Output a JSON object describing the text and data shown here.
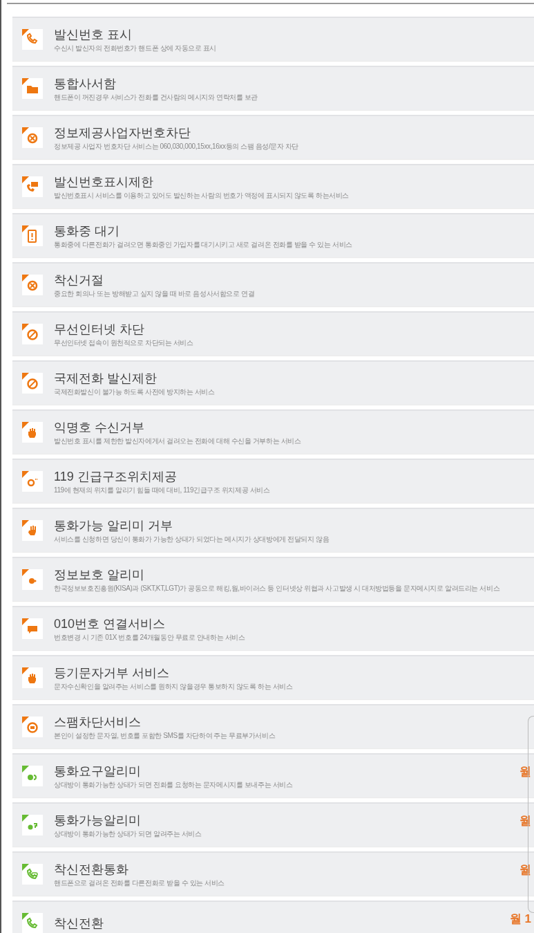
{
  "services": [
    {
      "kind": "free",
      "title": "발신번호 표시",
      "description": "수신시 발신자의 전화번호가 핸드폰 상에 자동으로 표시"
    },
    {
      "kind": "free",
      "title": "통합사서함",
      "description": "핸드폰이 꺼진경우 서비스가 전화를 건사람의 메시지와 연락처를 보관"
    },
    {
      "kind": "free",
      "title": "정보제공사업자번호차단",
      "description": "정보제공 사업자 번호차단 서비스는 060,030,000,15xx,16xx등의 스팸 음성/문자 차단"
    },
    {
      "kind": "free",
      "title": "발신번호표시제한",
      "description": "발신번호표시 서비스를 이용하고 있어도 발신하는 사람의 번호가 액정에 표시되지 않도록 하는서비스"
    },
    {
      "kind": "free",
      "title": "통화중 대기",
      "description": "통화중에 다른전화가 걸려오면 통화중인 가입자를 대기시키고 새로 걸려온 전화를 받을 수 있는 서비스"
    },
    {
      "kind": "free",
      "title": "착신거절",
      "description": "중요한 회의나 또는 방해받고 싶지 않을 때 바로 음성사서함으로 연결"
    },
    {
      "kind": "free",
      "title": "무선인터넷 차단",
      "description": "무선인터넷 접속이 원천적으로 차단되는 서비스"
    },
    {
      "kind": "free",
      "title": "국제전화 발신제한",
      "description": "국제전화발신이 불가능 하도록 사전에 방지하는 서비스"
    },
    {
      "kind": "free",
      "title": "익명호 수신거부",
      "description": "발신번호 표시를 제한한 발신자에게서 걸려오는 전화에 대해 수신을 거부하는 서비스"
    },
    {
      "kind": "free",
      "title": "119 긴급구조위치제공",
      "description": "119에 현재의 위치를 알리기 힘들 때에 대비, 119긴급구조 위치제공 서비스"
    },
    {
      "kind": "free",
      "title": "통화가능 알리미 거부",
      "description": "서비스를 신청하면 당신이 통화가 가능한 상태가 되었다는 메시지가 상대방에게 전달되지 않음"
    },
    {
      "kind": "free",
      "title": "정보보호 알리미",
      "description": "한국정보보호진흥원(KISA)과 (SKT,KT,LGT)가 공동으로 해킹,웜,바이러스 등 인터넷상 위협과 사고발생 시 대처방법등을 문자메시지로 알려드리는 서비스"
    },
    {
      "kind": "free",
      "title": "010번호 연결서비스",
      "description": "번호변경 시 기존 01X 번호를 24개월동안 무료로 안내하는 서비스"
    },
    {
      "kind": "free",
      "title": "등기문자거부 서비스",
      "description": "문자수신확인을 알려주는 서비스를 원하지 않을경우 통보하지 않도록 하는 서비스"
    },
    {
      "kind": "free",
      "title": "스팸차단서비스",
      "description": "본인이 설정한 문자열, 번호를 포함한 SMS를 차단하여 주는 무료부가서비스"
    },
    {
      "kind": "paid",
      "title": "통화요구알리미",
      "description": "상대방이 통화가능한 상태가 되면 전화를 요청하는 문자메시지를 보내주는 서비스",
      "price": "월"
    },
    {
      "kind": "paid",
      "title": "통화가능알리미",
      "description": "상대방이 통화가능한 상태가 되면 알려주는 서비스",
      "price": "월"
    },
    {
      "kind": "paid",
      "title": "착신전환통화",
      "description": "핸드폰으로 걸려온 전화를 다른전화로 받을 수 있는 서비스",
      "price": "월"
    },
    {
      "kind": "paid",
      "title": "착신전환",
      "price": "월 1"
    }
  ]
}
